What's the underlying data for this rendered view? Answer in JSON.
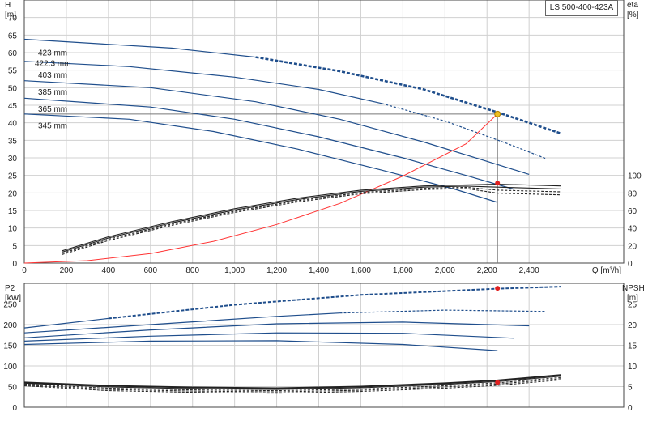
{
  "model_label": "LS 500-400-423A",
  "colors": {
    "pump_curve": "#1f4e8c",
    "system_curve": "#ff3333",
    "efficiency": "#222222",
    "op_point": "#f0c020",
    "marker_red": "#e02020",
    "grid": "#d0d0d0"
  },
  "chart_data": [
    {
      "type": "line",
      "name": "head",
      "ylabel_lines": [
        "H",
        "[m]"
      ],
      "ylabel_right_lines": [
        "eta",
        "[%]"
      ],
      "xlabel": "Q [m³/h]",
      "x_ticks": [
        0,
        200,
        400,
        600,
        800,
        1000,
        1200,
        1400,
        1600,
        1800,
        2000,
        2200,
        2400
      ],
      "x_tick_labels": [
        "0",
        "200",
        "400",
        "600",
        "800",
        "1,000",
        "1,200",
        "1,400",
        "1,600",
        "1,800",
        "2,000",
        "2,200",
        "2,400"
      ],
      "xlim": [
        0,
        2850
      ],
      "ylim": [
        0,
        75
      ],
      "y_ticks": [
        0,
        5,
        10,
        15,
        20,
        25,
        30,
        35,
        40,
        45,
        50,
        55,
        60,
        65,
        70
      ],
      "eta_ticks": [
        0,
        20,
        40,
        60,
        80,
        100
      ],
      "eta_per_m": 4,
      "grid": true,
      "impeller_labels": [
        "423 mm",
        "422.3 mm",
        "403 mm",
        "385 mm",
        "365 mm",
        "345 mm"
      ],
      "series": [
        {
          "label_index": 0,
          "solid": [
            [
              0,
              63.8
            ],
            [
              700,
              61.3
            ],
            [
              1100,
              58.7
            ]
          ],
          "dashed": [
            [
              1100,
              58.7
            ],
            [
              1500,
              54.7
            ],
            [
              1900,
              49.5
            ],
            [
              2250,
              43.0
            ],
            [
              2550,
              37.0
            ]
          ],
          "bold_dash": true
        },
        {
          "label_index": 2,
          "solid": [
            [
              0,
              57.5
            ],
            [
              500,
              56.0
            ],
            [
              1000,
              53.0
            ],
            [
              1400,
              49.5
            ],
            [
              1700,
              45.5
            ]
          ],
          "dashed": [
            [
              1700,
              45.5
            ],
            [
              2000,
              40.5
            ],
            [
              2300,
              34.0
            ],
            [
              2480,
              29.8
            ]
          ]
        },
        {
          "label_index": 3,
          "solid": [
            [
              0,
              52.0
            ],
            [
              600,
              50.0
            ],
            [
              1100,
              46.0
            ],
            [
              1500,
              41.0
            ],
            [
              1900,
              34.5
            ],
            [
              2200,
              29.0
            ],
            [
              2400,
              25.3
            ]
          ]
        },
        {
          "label_index": 4,
          "solid": [
            [
              0,
              47.0
            ],
            [
              600,
              44.5
            ],
            [
              1000,
              41.0
            ],
            [
              1400,
              36.0
            ],
            [
              1800,
              30.0
            ],
            [
              2100,
              25.0
            ],
            [
              2330,
              21.0
            ]
          ]
        },
        {
          "label_index": 5,
          "solid": [
            [
              0,
              42.5
            ],
            [
              500,
              41.0
            ],
            [
              900,
              37.5
            ],
            [
              1300,
              32.5
            ],
            [
              1700,
              26.5
            ],
            [
              2050,
              21.0
            ],
            [
              2250,
              17.3
            ]
          ]
        }
      ],
      "system_curve": [
        [
          0,
          0
        ],
        [
          300,
          0.7
        ],
        [
          600,
          2.7
        ],
        [
          900,
          6.2
        ],
        [
          1200,
          11.0
        ],
        [
          1500,
          17.0
        ],
        [
          1800,
          24.8
        ],
        [
          2100,
          34.0
        ],
        [
          2250,
          42.5
        ]
      ],
      "efficiency_curve": [
        [
          180,
          3.5
        ],
        [
          400,
          7.5
        ],
        [
          700,
          11.8
        ],
        [
          1000,
          15.5
        ],
        [
          1300,
          18.5
        ],
        [
          1600,
          20.8
        ],
        [
          1900,
          22.0
        ],
        [
          2100,
          22.3
        ],
        [
          2250,
          22.5
        ],
        [
          2550,
          22.0
        ]
      ],
      "duty_point": {
        "q": 2250,
        "h": 42.5
      },
      "eta_point": {
        "q": 2250,
        "h": 22.8
      },
      "h_reference": 42.5
    },
    {
      "type": "line",
      "name": "power",
      "ylabel_lines": [
        "P2",
        "[kW]"
      ],
      "ylabel_right_lines": [
        "NPSH",
        "[m]"
      ],
      "xlim": [
        0,
        2850
      ],
      "ylim": [
        0,
        300
      ],
      "y_ticks": [
        0,
        50,
        100,
        150,
        200,
        250
      ],
      "npsh_ticks": [
        0,
        5,
        10,
        15,
        20,
        25
      ],
      "npsh_per_kw": 0.1,
      "grid": true,
      "series": [
        {
          "solid": [
            [
              0,
              192
            ],
            [
              400,
              215
            ]
          ],
          "dashed": [
            [
              400,
              215
            ],
            [
              1000,
              248
            ],
            [
              1600,
              272
            ],
            [
              2250,
              287
            ],
            [
              2550,
              292
            ]
          ],
          "bold_dash": true
        },
        {
          "solid": [
            [
              0,
              180
            ],
            [
              600,
              200
            ],
            [
              1200,
              220
            ],
            [
              1500,
              228
            ]
          ],
          "dashed": [
            [
              1500,
              228
            ],
            [
              2000,
              235
            ],
            [
              2480,
              232
            ]
          ]
        },
        {
          "solid": [
            [
              0,
              168
            ],
            [
              600,
              187
            ],
            [
              1200,
              202
            ],
            [
              1800,
              206
            ],
            [
              2400,
              197
            ]
          ]
        },
        {
          "solid": [
            [
              0,
              160
            ],
            [
              600,
              172
            ],
            [
              1200,
              180
            ],
            [
              1800,
              179
            ],
            [
              2330,
              167
            ]
          ]
        },
        {
          "solid": [
            [
              0,
              152
            ],
            [
              600,
              160
            ],
            [
              1200,
              161
            ],
            [
              1800,
              152
            ],
            [
              2250,
              137
            ]
          ]
        }
      ],
      "npsh_curve": [
        [
          0,
          60
        ],
        [
          400,
          52
        ],
        [
          800,
          48
        ],
        [
          1200,
          46
        ],
        [
          1600,
          50
        ],
        [
          2000,
          58
        ],
        [
          2250,
          65
        ],
        [
          2550,
          78
        ]
      ],
      "power_point": {
        "q": 2250,
        "p": 288
      },
      "npsh_point": {
        "q": 2250,
        "p": 60
      }
    }
  ]
}
